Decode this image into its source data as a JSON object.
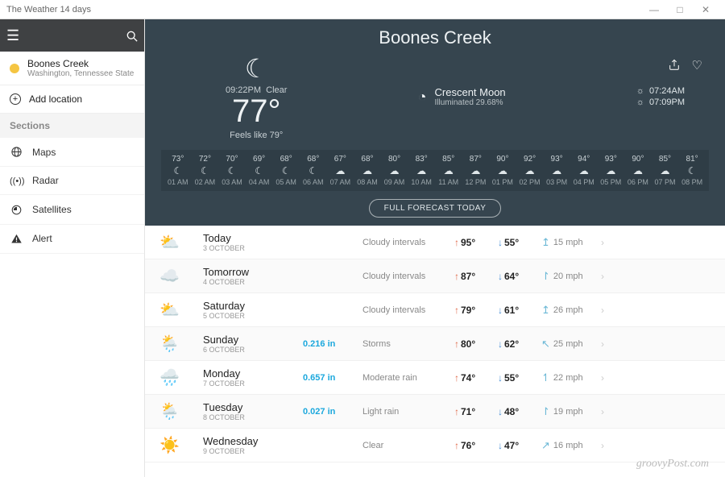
{
  "window": {
    "title": "The Weather 14 days"
  },
  "sidebar": {
    "location": {
      "name": "Boones Creek",
      "sub": "Washington, Tennessee State"
    },
    "add_label": "Add location",
    "sections_header": "Sections",
    "items": [
      {
        "label": "Maps",
        "icon": "globe-icon"
      },
      {
        "label": "Radar",
        "icon": "radar-icon"
      },
      {
        "label": "Satellites",
        "icon": "satellite-icon"
      },
      {
        "label": "Alert",
        "icon": "alert-icon"
      }
    ]
  },
  "hero": {
    "city": "Boones Creek",
    "time": "09:22PM",
    "condition": "Clear",
    "temp": "77°",
    "feels": "Feels like 79°",
    "moon_phase": "Crescent Moon",
    "moon_illum": "Illuminated 29.68%",
    "sunrise": "07:24AM",
    "sunset": "07:09PM"
  },
  "hourly": [
    {
      "t": "73°",
      "i": "☾",
      "h": "01 AM"
    },
    {
      "t": "72°",
      "i": "☾",
      "h": "02 AM"
    },
    {
      "t": "70°",
      "i": "☾",
      "h": "03 AM"
    },
    {
      "t": "69°",
      "i": "☾",
      "h": "04 AM"
    },
    {
      "t": "68°",
      "i": "☾",
      "h": "05 AM"
    },
    {
      "t": "68°",
      "i": "☾",
      "h": "06 AM"
    },
    {
      "t": "67°",
      "i": "☁",
      "h": "07 AM"
    },
    {
      "t": "68°",
      "i": "☁",
      "h": "08 AM"
    },
    {
      "t": "80°",
      "i": "☁",
      "h": "09 AM"
    },
    {
      "t": "83°",
      "i": "☁",
      "h": "10 AM"
    },
    {
      "t": "85°",
      "i": "☁",
      "h": "11 AM"
    },
    {
      "t": "87°",
      "i": "☁",
      "h": "12 PM"
    },
    {
      "t": "90°",
      "i": "☁",
      "h": "01 PM"
    },
    {
      "t": "92°",
      "i": "☁",
      "h": "02 PM"
    },
    {
      "t": "93°",
      "i": "☁",
      "h": "03 PM"
    },
    {
      "t": "94°",
      "i": "☁",
      "h": "04 PM"
    },
    {
      "t": "93°",
      "i": "☁",
      "h": "05 PM"
    },
    {
      "t": "90°",
      "i": "☁",
      "h": "06 PM"
    },
    {
      "t": "85°",
      "i": "☁",
      "h": "07 PM"
    },
    {
      "t": "81°",
      "i": "☾",
      "h": "08 PM"
    }
  ],
  "full_forecast_btn": "FULL FORECAST TODAY",
  "forecast": [
    {
      "icon": "⛅",
      "day": "Today",
      "date": "3 OCTOBER",
      "precip": "",
      "cond": "Cloudy intervals",
      "hi": "95°",
      "lo": "55°",
      "warr": "↥",
      "wind": "15 mph"
    },
    {
      "icon": "☁️",
      "day": "Tomorrow",
      "date": "4 OCTOBER",
      "precip": "",
      "cond": "Cloudy intervals",
      "hi": "87°",
      "lo": "64°",
      "warr": "↾",
      "wind": "20 mph"
    },
    {
      "icon": "⛅",
      "day": "Saturday",
      "date": "5 OCTOBER",
      "precip": "",
      "cond": "Cloudy intervals",
      "hi": "79°",
      "lo": "61°",
      "warr": "↥",
      "wind": "26 mph"
    },
    {
      "icon": "🌦️",
      "day": "Sunday",
      "date": "6 OCTOBER",
      "precip": "0.216 in",
      "cond": "Storms",
      "hi": "80°",
      "lo": "62°",
      "warr": "↖",
      "wind": "25 mph"
    },
    {
      "icon": "🌧️",
      "day": "Monday",
      "date": "7 OCTOBER",
      "precip": "0.657 in",
      "cond": "Moderate rain",
      "hi": "74°",
      "lo": "55°",
      "warr": "↿",
      "wind": "22 mph"
    },
    {
      "icon": "🌦️",
      "day": "Tuesday",
      "date": "8 OCTOBER",
      "precip": "0.027 in",
      "cond": "Light rain",
      "hi": "71°",
      "lo": "48°",
      "warr": "↾",
      "wind": "19 mph"
    },
    {
      "icon": "☀️",
      "day": "Wednesday",
      "date": "9 OCTOBER",
      "precip": "",
      "cond": "Clear",
      "hi": "76°",
      "lo": "47°",
      "warr": "↗",
      "wind": "16 mph"
    }
  ],
  "watermark": "groovyPost.com"
}
